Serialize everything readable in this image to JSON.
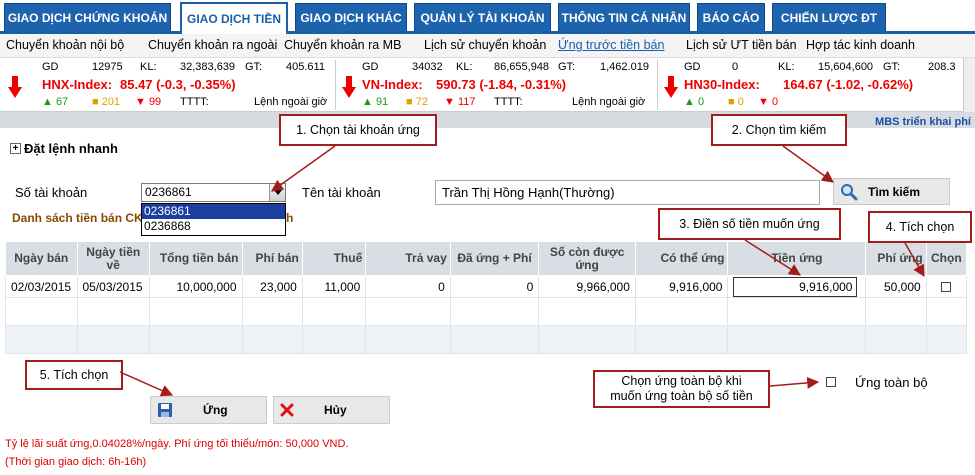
{
  "top_tabs": [
    "GIAO DỊCH CHỨNG KHOÁN",
    "GIAO DỊCH TIỀN",
    "GIAO DỊCH KHÁC",
    "QUẢN LÝ TÀI KHOẢN",
    "THÔNG TIN CÁ NHÂN",
    "BÁO CÁO",
    "CHIẾN LƯỢC ĐT"
  ],
  "active_tab": "GIAO DỊCH TIỀN",
  "sub_nav": [
    "Chuyển khoản nội bộ",
    "Chuyển khoản ra ngoài",
    "Chuyển khoản ra MB",
    "Lịch sử chuyển khoản",
    "Ứng trước tiền bán",
    "Lịch sử ƯT tiền bán",
    "Hợp tác kinh doanh"
  ],
  "ticker": [
    {
      "gd": "GD",
      "gd_val": "12975",
      "kl": "KL:",
      "kl_val": "32,383,639",
      "gt": "GT:",
      "gt_val": "405.611",
      "index": "HNX-Index:",
      "index_val": "85.47 (-0.3, -0.35%)",
      "up": "▲ 67",
      "eq": "■ 201",
      "dn": "▼ 99",
      "tttt": "TTTT:",
      "status": "Lệnh ngoài giờ"
    },
    {
      "gd": "GD",
      "gd_val": "34032",
      "kl": "KL:",
      "kl_val": "86,655,948",
      "gt": "GT:",
      "gt_val": "1,462.019",
      "index": "VN-Index:",
      "index_val": "590.73 (-1.84, -0.31%)",
      "up": "▲ 91",
      "eq": "■ 72",
      "dn": "▼ 117",
      "tttt": "TTTT:",
      "status": "Lệnh ngoài giờ"
    },
    {
      "gd": "GD",
      "gd_val": "0",
      "kl": "KL:",
      "kl_val": "15,604,600",
      "gt": "GT:",
      "gt_val": "208.3",
      "index": "HN30-Index:",
      "index_val": "164.67 (-1.02, -0.62%)",
      "up": "▲ 0",
      "eq": "■ 0",
      "dn": "▼ 0"
    }
  ],
  "mbs_note": "MBS triển khai phí",
  "quick_order": "Đặt lệnh nhanh",
  "form": {
    "account_label": "Số tài khoản",
    "account_value": "0236861",
    "account_options": [
      "0236861",
      "0236868"
    ],
    "name_label": "Tên tài khoản",
    "name_value": "Trần Thị Hồng Hạnh(Thường)",
    "search_label": "Tìm kiếm",
    "list_label": "Danh sách tiền bán CK",
    "list_tail": "h"
  },
  "table": {
    "headers": [
      "Ngày bán",
      "Ngày tiền về",
      "Tổng tiền bán",
      "Phí bán",
      "Thuế",
      "Trả vay",
      "Đã ứng + Phí",
      "Số còn được ứng",
      "Có thể ứng",
      "Tiền ứng",
      "Phí ứng",
      "Chọn"
    ],
    "rows": [
      [
        "02/03/2015",
        "05/03/2015",
        "10,000,000",
        "23,000",
        "11,000",
        "0",
        "0",
        "9,966,000",
        "9,916,000",
        "9,916,000",
        "50,000",
        ""
      ]
    ]
  },
  "buttons": {
    "ung": "Ứng",
    "huy": "Hủy"
  },
  "ung_toan_bo": "Ứng toàn bộ",
  "footnotes": [
    "Tỷ lệ lãi suất ứng,0.04028%/ngày. Phí ứng tối thiểu/món: 50,000 VND.",
    "(Thời gian giao dịch: 6h-16h)"
  ],
  "callouts": {
    "c1": "1. Chọn tài khoản ứng",
    "c2": "2. Chọn tìm kiếm",
    "c3": "3. Điền số tiền muốn ứng",
    "c4": "4. Tích chọn",
    "c5": "5. Tích chọn",
    "c6a": "Chọn ứng toàn bộ khi",
    "c6b": "muốn ứng toàn bộ số tiền"
  },
  "colors": {
    "brand": "#1d63ae",
    "alert": "#e00000",
    "callout_border": "#a31c1c"
  }
}
